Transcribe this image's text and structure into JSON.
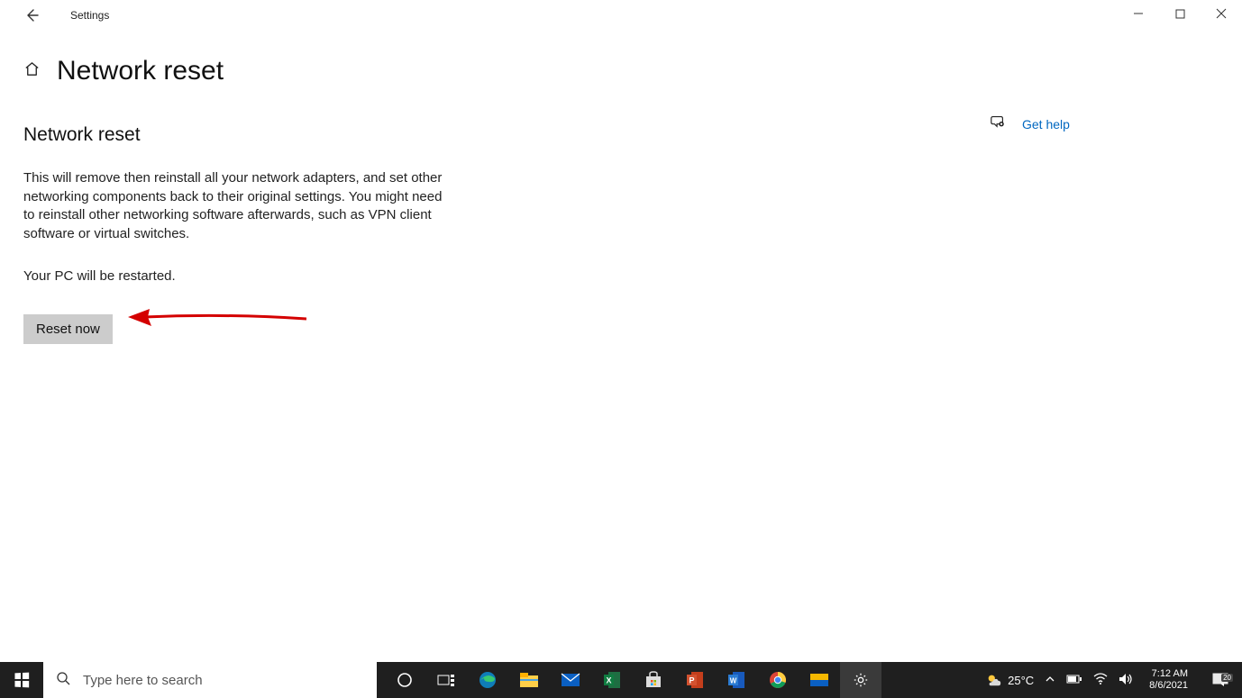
{
  "window": {
    "app_title": "Settings"
  },
  "page": {
    "title": "Network reset",
    "section_heading": "Network reset",
    "description": "This will remove then reinstall all your network adapters, and set other networking components back to their original settings. You might need to reinstall other networking software afterwards, such as VPN client software or virtual switches.",
    "restart_note": "Your PC will be restarted.",
    "reset_button_label": "Reset now",
    "help_link": "Get help"
  },
  "taskbar": {
    "search_placeholder": "Type here to search",
    "weather_temp": "25°C",
    "time": "7:12 AM",
    "date": "8/6/2021",
    "notification_count": "20"
  }
}
